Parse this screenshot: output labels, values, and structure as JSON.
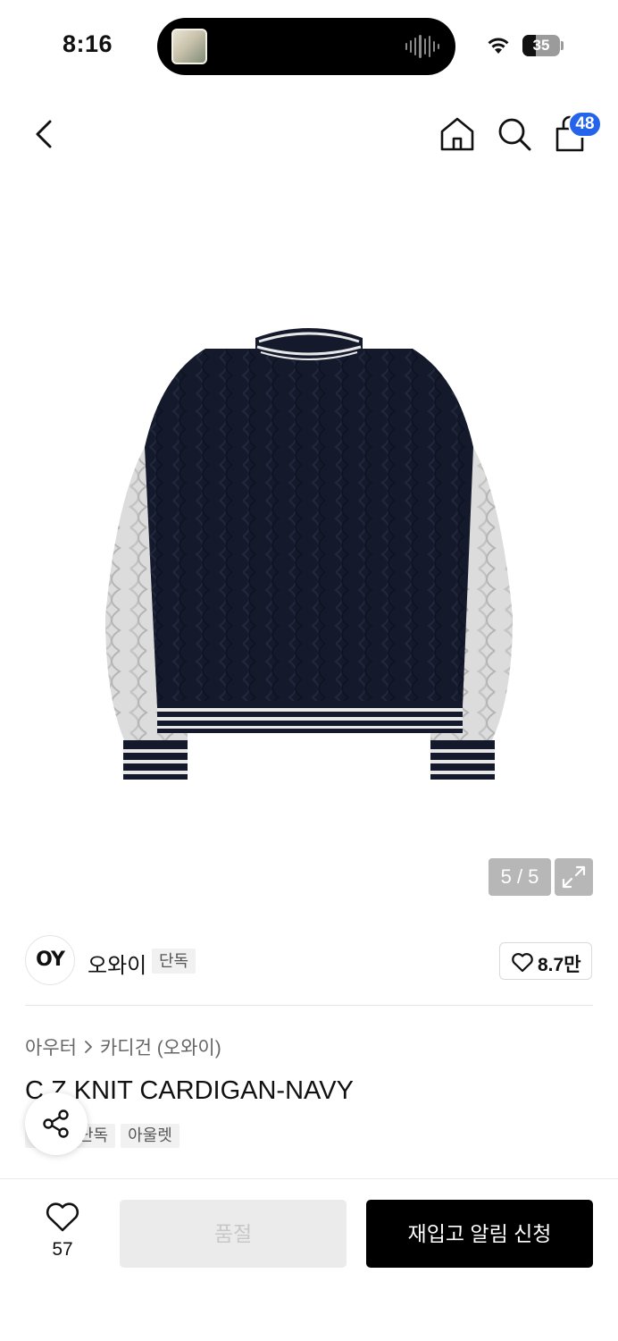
{
  "status_bar": {
    "time": "8:16",
    "battery": "35"
  },
  "nav": {
    "cart_count": "48"
  },
  "gallery": {
    "counter": "5 / 5"
  },
  "brand": {
    "logo_text": "OY",
    "name": "오와이",
    "tag": "단독",
    "likes": "8.7만"
  },
  "product": {
    "breadcrumb": [
      "아우터",
      "카디건 (오와이)"
    ],
    "title": "C.Z KNIT CARDIGAN-NAVY",
    "tags": [
      "단독",
      "아울렛"
    ]
  },
  "bottom_bar": {
    "wish_count": "57",
    "soldout_label": "품절",
    "restock_label": "재입고 알림 신청"
  },
  "colors": {
    "accent_blue": "#2563eb",
    "cardigan_navy": "#141a2c",
    "sleeve_grey": "#d9d9d9",
    "primary_button": "#000000",
    "disabled_button": "#ebebeb"
  }
}
